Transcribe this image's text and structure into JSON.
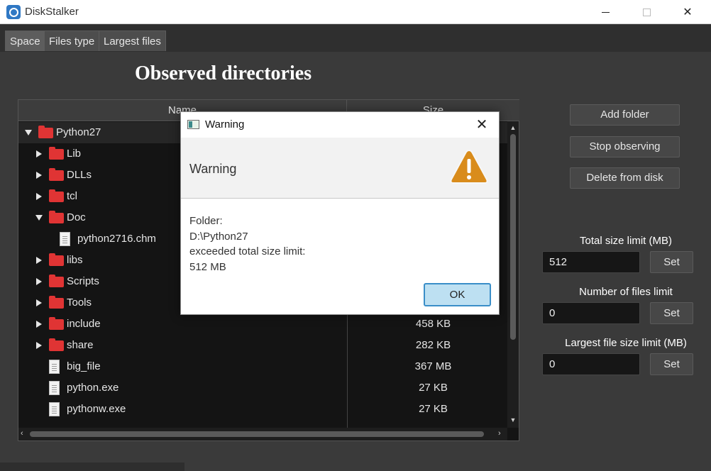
{
  "window": {
    "title": "DiskStalker"
  },
  "tabs": [
    {
      "label": "Space"
    },
    {
      "label": "Files type"
    },
    {
      "label": "Largest files"
    }
  ],
  "main": {
    "heading": "Observed directories"
  },
  "table": {
    "columns": {
      "name": "Name",
      "size": "Size"
    },
    "rows": [
      {
        "label": "Python27",
        "size": "",
        "type": "folder",
        "expand": "expanded",
        "level": 0
      },
      {
        "label": "Lib",
        "size": "",
        "type": "folder",
        "expand": "collapsed",
        "level": 1
      },
      {
        "label": "DLLs",
        "size": "",
        "type": "folder",
        "expand": "collapsed",
        "level": 1
      },
      {
        "label": "tcl",
        "size": "",
        "type": "folder",
        "expand": "collapsed",
        "level": 1
      },
      {
        "label": "Doc",
        "size": "",
        "type": "folder",
        "expand": "expanded",
        "level": 1
      },
      {
        "label": "python2716.chm",
        "size": "",
        "type": "file",
        "expand": "none",
        "level": 2
      },
      {
        "label": "libs",
        "size": "",
        "type": "folder",
        "expand": "collapsed",
        "level": 1
      },
      {
        "label": "Scripts",
        "size": "",
        "type": "folder",
        "expand": "collapsed",
        "level": 1
      },
      {
        "label": "Tools",
        "size": "",
        "type": "folder",
        "expand": "collapsed",
        "level": 1
      },
      {
        "label": "include",
        "size": "458 KB",
        "type": "folder",
        "expand": "collapsed",
        "level": 1
      },
      {
        "label": "share",
        "size": "282 KB",
        "type": "folder",
        "expand": "collapsed",
        "level": 1
      },
      {
        "label": "big_file",
        "size": "367 MB",
        "type": "file",
        "expand": "none",
        "level": 1
      },
      {
        "label": "python.exe",
        "size": "27 KB",
        "type": "file",
        "expand": "none",
        "level": 1
      },
      {
        "label": "pythonw.exe",
        "size": "27 KB",
        "type": "file",
        "expand": "none",
        "level": 1
      }
    ]
  },
  "actions": {
    "add_folder": "Add folder",
    "stop_observing": "Stop observing",
    "delete_from_disk": "Delete from disk"
  },
  "limits": {
    "total_size": {
      "label": "Total size limit (MB)",
      "value": "512",
      "button": "Set"
    },
    "files_count": {
      "label": "Number of files limit",
      "value": "0",
      "button": "Set"
    },
    "largest_file": {
      "label": "Largest file size limit (MB)",
      "value": "0",
      "button": "Set"
    }
  },
  "dialog": {
    "title": "Warning",
    "header": "Warning",
    "lines": [
      "Folder:",
      "D:\\Python27",
      "exceeded total size limit:",
      "512 MB"
    ],
    "ok": "OK",
    "icon": "warning-triangle-icon"
  },
  "colors": {
    "folder": "#e03434",
    "background": "#3a3a3a",
    "table_bg": "#141414",
    "accent": "#3a8ec8"
  }
}
